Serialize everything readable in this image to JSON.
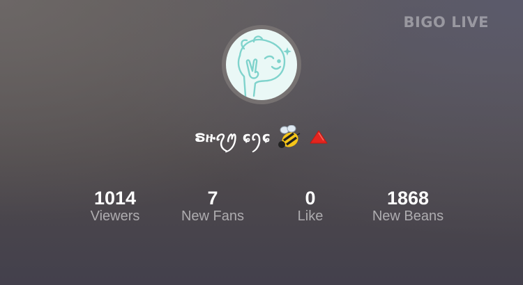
{
  "brand": {
    "label": "BIGO LIVE"
  },
  "profile": {
    "username": "ຣዙꪖꪑ ɕꪆɕ",
    "avatar_icon": "bigo-mascot-peace-sign",
    "badges": [
      "bee-emoji-icon",
      "red-triangle-icon"
    ]
  },
  "stats": [
    {
      "value": "1014",
      "label": "Viewers"
    },
    {
      "value": "7",
      "label": "New Fans"
    },
    {
      "value": "0",
      "label": "Like"
    },
    {
      "value": "1868",
      "label": "New Beans"
    }
  ],
  "colors": {
    "avatar_bg": "#eaf8f6",
    "avatar_line": "#7fd3cc",
    "ring": "#767171",
    "label_gray": "rgba(255,255,255,0.55)"
  }
}
